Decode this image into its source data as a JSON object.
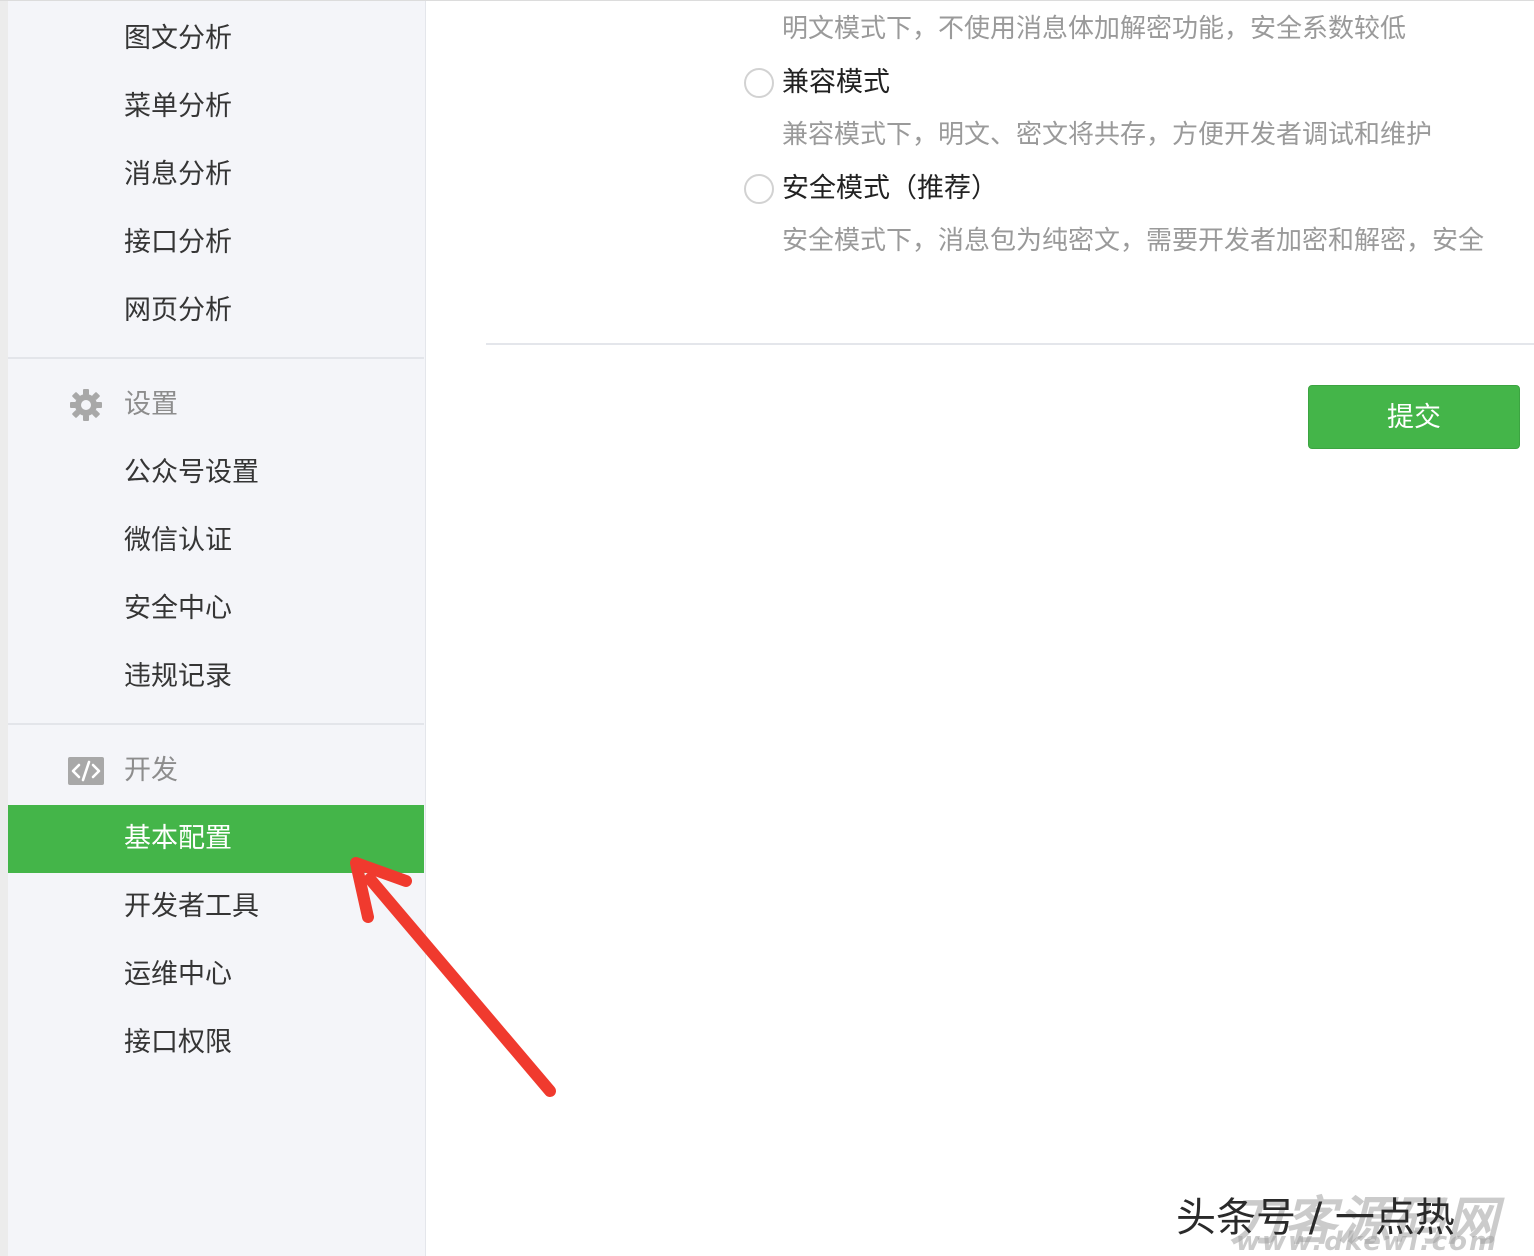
{
  "sidebar": {
    "top_items": [
      {
        "label": "图文分析"
      },
      {
        "label": "菜单分析"
      },
      {
        "label": "消息分析"
      },
      {
        "label": "接口分析"
      },
      {
        "label": "网页分析"
      }
    ],
    "settings_group": {
      "title": "设置",
      "icon": "gear-icon",
      "items": [
        {
          "label": "公众号设置"
        },
        {
          "label": "微信认证"
        },
        {
          "label": "安全中心"
        },
        {
          "label": "违规记录"
        }
      ]
    },
    "dev_group": {
      "title": "开发",
      "icon": "code-icon",
      "items": [
        {
          "label": "基本配置",
          "active": true
        },
        {
          "label": "开发者工具"
        },
        {
          "label": "运维中心"
        },
        {
          "label": "接口权限"
        }
      ]
    }
  },
  "main": {
    "plaintext_desc": "明文模式下，不使用消息体加解密功能，安全系数较低",
    "modes": [
      {
        "label": "兼容模式",
        "description": "兼容模式下，明文、密文将共存，方便开发者调试和维护",
        "selected": false
      },
      {
        "label": "安全模式（推荐）",
        "description": "安全模式下，消息包为纯密文，需要开发者加密和解密，安全",
        "selected": false
      }
    ],
    "submit_label": "提交"
  },
  "watermark": {
    "author": "头条号 / 一点热",
    "logo_text": "刀客源码网",
    "logo_sub": "www.dkewl.com"
  },
  "colors": {
    "accent": "#44b549",
    "arrow": "#f03a2e"
  }
}
